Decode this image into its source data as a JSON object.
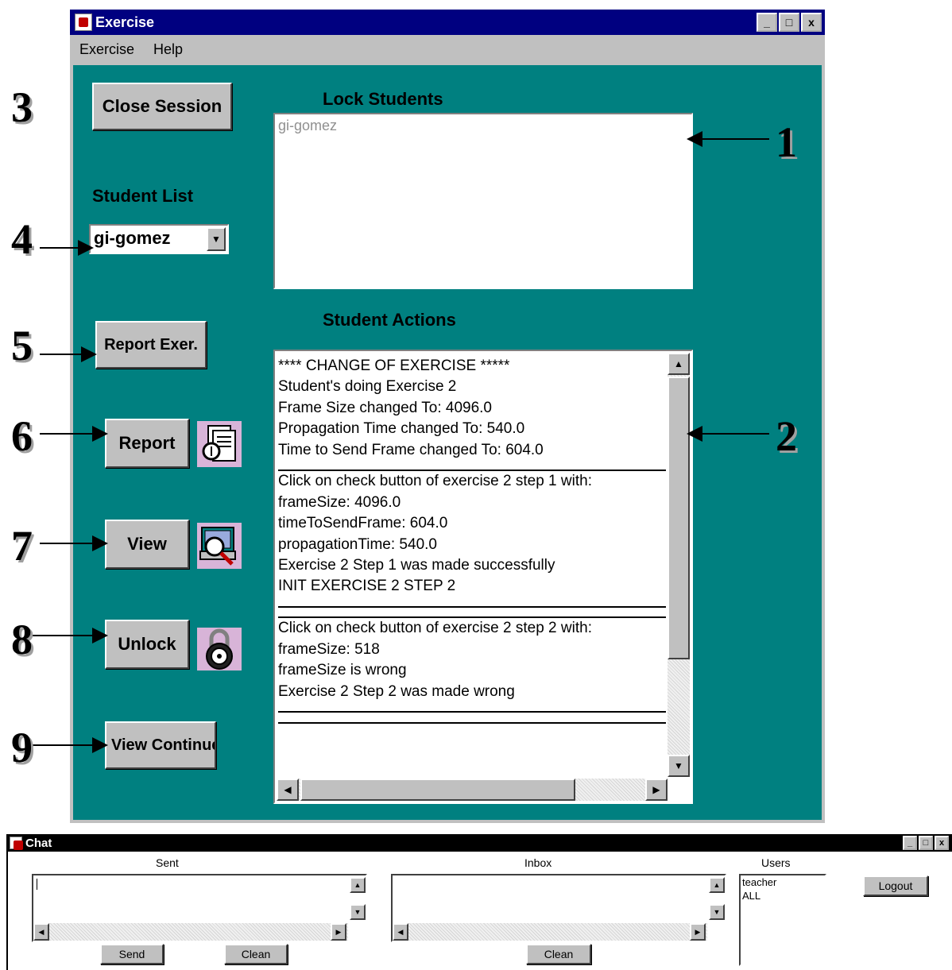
{
  "exercise_window": {
    "title": "Exercise",
    "menu": [
      "Exercise",
      "Help"
    ],
    "window_buttons": [
      "_",
      "□",
      "x"
    ],
    "buttons": {
      "close_session": "Close Session",
      "report_exer": "Report Exer.",
      "report": "Report",
      "view": "View",
      "unlock": "Unlock",
      "view_continue": "View Continue"
    },
    "labels": {
      "lock_students": "Lock Students",
      "student_list": "Student List",
      "student_actions": "Student Actions"
    },
    "student_list_selected": "gi-gomez",
    "lock_students_items": [
      "gi-gomez"
    ],
    "student_actions_lines": [
      "**** CHANGE OF EXERCISE *****",
      "Student's doing Exercise 2",
      "Frame Size changed To: 4096.0",
      "Propagation Time changed To: 540.0",
      "Time to Send Frame changed To: 604.0",
      "---",
      "Click on check button of exercise 2 step 1 with:",
      "frameSize: 4096.0",
      "timeToSendFrame: 604.0",
      "propagationTime: 540.0",
      "Exercise 2 Step 1 was made successfully",
      "INIT EXERCISE 2 STEP 2",
      "---",
      "---",
      "Click on check button of exercise 2 step 2 with:",
      "frameSize: 518",
      "frameSize is wrong",
      "Exercise 2 Step 2 was made wrong",
      "---",
      "---"
    ]
  },
  "callouts": [
    "1",
    "2",
    "3",
    "4",
    "5",
    "6",
    "7",
    "8",
    "9"
  ],
  "chat_window": {
    "title": "Chat",
    "sent_label": "Sent",
    "inbox_label": "Inbox",
    "users_label": "Users",
    "users": [
      "teacher",
      "ALL"
    ],
    "buttons": {
      "send": "Send",
      "clean_sent": "Clean",
      "clean_inbox": "Clean",
      "logout": "Logout"
    }
  }
}
